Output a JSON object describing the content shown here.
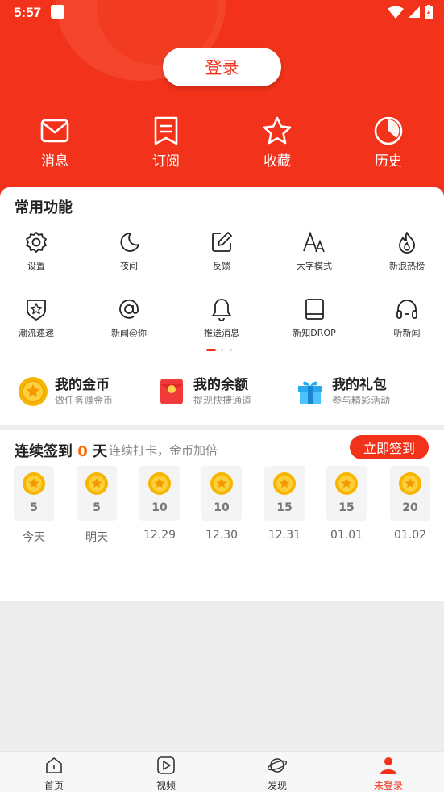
{
  "status_bar": {
    "time": "5:57"
  },
  "header": {
    "login_label": "登录",
    "quick_nav": [
      {
        "label": "消息",
        "icon": "mail-icon"
      },
      {
        "label": "订阅",
        "icon": "bookmark-list-icon"
      },
      {
        "label": "收藏",
        "icon": "star-icon"
      },
      {
        "label": "历史",
        "icon": "clock-icon"
      }
    ],
    "accent_color": "#f2321a"
  },
  "common_functions": {
    "title": "常用功能",
    "items": [
      {
        "label": "设置",
        "icon": "gear-icon"
      },
      {
        "label": "夜间",
        "icon": "moon-icon"
      },
      {
        "label": "反馈",
        "icon": "edit-icon"
      },
      {
        "label": "大字模式",
        "icon": "font-size-icon"
      },
      {
        "label": "新浪热榜",
        "icon": "flame-icon"
      },
      {
        "label": "潮流速递",
        "icon": "badge-star-icon"
      },
      {
        "label": "新闻@你",
        "icon": "at-icon"
      },
      {
        "label": "推送消息",
        "icon": "bell-icon"
      },
      {
        "label": "新知DROP",
        "icon": "book-icon"
      },
      {
        "label": "听新闻",
        "icon": "headphones-icon"
      }
    ],
    "page_indicator": {
      "pages": 3,
      "current": 1
    }
  },
  "assets": [
    {
      "title": "我的金币",
      "subtitle": "做任务赚金币",
      "icon": "gold-coin-icon"
    },
    {
      "title": "我的余额",
      "subtitle": "提现快捷通道",
      "icon": "red-envelope-icon"
    },
    {
      "title": "我的礼包",
      "subtitle": "参与精彩活动",
      "icon": "gift-icon"
    }
  ],
  "checkin": {
    "title_prefix": "连续签到",
    "days_count": "0",
    "title_suffix": "天",
    "subtitle": "连续打卡，金币加倍",
    "button_label": "立即签到",
    "days": [
      {
        "points": "5",
        "label": "今天"
      },
      {
        "points": "5",
        "label": "明天"
      },
      {
        "points": "10",
        "label": "12.29"
      },
      {
        "points": "10",
        "label": "12.30"
      },
      {
        "points": "15",
        "label": "12.31"
      },
      {
        "points": "15",
        "label": "01.01"
      },
      {
        "points": "20",
        "label": "01.02"
      }
    ]
  },
  "bottom_nav": [
    {
      "label": "首页",
      "icon": "home-icon",
      "active": false
    },
    {
      "label": "视频",
      "icon": "video-icon",
      "active": false
    },
    {
      "label": "发现",
      "icon": "planet-icon",
      "active": false
    },
    {
      "label": "未登录",
      "icon": "user-icon",
      "active": true
    }
  ]
}
